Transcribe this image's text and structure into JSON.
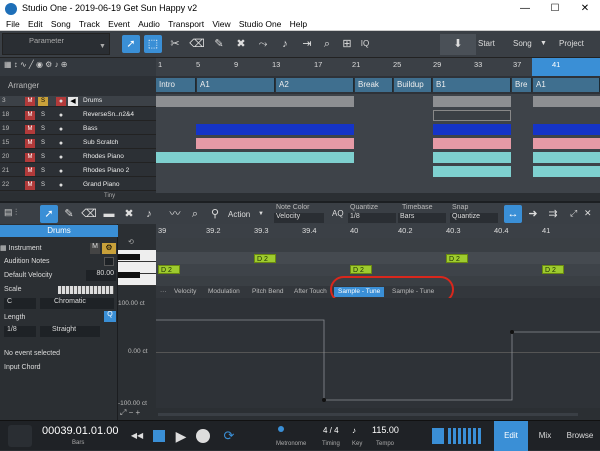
{
  "window": {
    "title": "Studio One - 2019-06-19 Get Sun Happy v2",
    "controls": [
      "—",
      "☐",
      "✕"
    ]
  },
  "menu": [
    "File",
    "Edit",
    "Song",
    "Track",
    "Event",
    "Audio",
    "Transport",
    "View",
    "Studio One",
    "Help"
  ],
  "toolbar": {
    "parameter_label": "Parameter",
    "iq": "IQ",
    "start": "Start",
    "song": "Song",
    "project": "Project"
  },
  "arranger": {
    "label": "Arranger",
    "ruler": [
      "1",
      "5",
      "9",
      "13",
      "17",
      "21",
      "25",
      "29",
      "33",
      "37",
      "41"
    ],
    "sections": [
      {
        "name": "Intro"
      },
      {
        "name": "A1"
      },
      {
        "name": "A2"
      },
      {
        "name": "Break"
      },
      {
        "name": "Buildup"
      },
      {
        "name": "B1"
      },
      {
        "name": "Bre"
      },
      {
        "name": "A1"
      }
    ],
    "tracks": [
      {
        "num": "3",
        "name": "Drums"
      },
      {
        "num": "18",
        "name": "ReverseSn..n2&4"
      },
      {
        "num": "19",
        "name": "Bass"
      },
      {
        "num": "15",
        "name": "Sub Scratch"
      },
      {
        "num": "20",
        "name": "Rhodes Piano"
      },
      {
        "num": "21",
        "name": "Rhodes Piano 2"
      },
      {
        "num": "22",
        "name": "Grand Piano"
      }
    ],
    "footer": "Tiny",
    "m": "M",
    "s": "S"
  },
  "editor": {
    "action": "Action",
    "note_color_label": "Note Color",
    "note_color_value": "Velocity",
    "aq": "AQ",
    "quantize_label": "Quantize",
    "quantize_value": "1/8",
    "timebase_label": "Timebase",
    "timebase_value": "Bars",
    "snap_label": "Snap",
    "snap_value": "Quantize",
    "track": "Drums",
    "instrument": "Instrument",
    "instrument_m": "M",
    "audition": "Audition Notes",
    "default_velocity_label": "Default Velocity",
    "default_velocity": "80.00",
    "scale_label": "Scale",
    "scale_key": "C",
    "scale_type": "Chromatic",
    "length_label": "Length",
    "length_value": "1/8",
    "length_mode": "Straight",
    "q": "Q",
    "no_event": "No event selected",
    "input_chord": "Input Chord",
    "ruler": [
      "39",
      "39.2",
      "39.3",
      "39.4",
      "40",
      "40.2",
      "40.3",
      "40.4",
      "41"
    ],
    "notes": [
      {
        "label": "D 2"
      },
      {
        "label": "D 2"
      },
      {
        "label": "D 2"
      },
      {
        "label": "D 2"
      },
      {
        "label": "D 2"
      }
    ],
    "tabs": [
      "Velocity",
      "Modulation",
      "Pitch Bend",
      "After Touch",
      "Sample - Tune",
      "Sample - Tune"
    ],
    "auto_max": "100.00 ct",
    "auto_mid": "0.00 ct",
    "auto_min": "-100.00 ct"
  },
  "transport": {
    "position": "00039.01.01.00",
    "position_label": "Bars",
    "timesig": "4 / 4",
    "timesig_label": "Timing",
    "key_label": "Key",
    "tempo": "115.00",
    "tempo_label": "Tempo",
    "metronome": "Metronome",
    "edit": "Edit",
    "mix": "Mix",
    "browse": "Browse"
  },
  "colors": {
    "accent": "#3a8fd6",
    "note": "#9ecb2e",
    "section": "#3f6f8f",
    "highlight": "#d9271c"
  }
}
